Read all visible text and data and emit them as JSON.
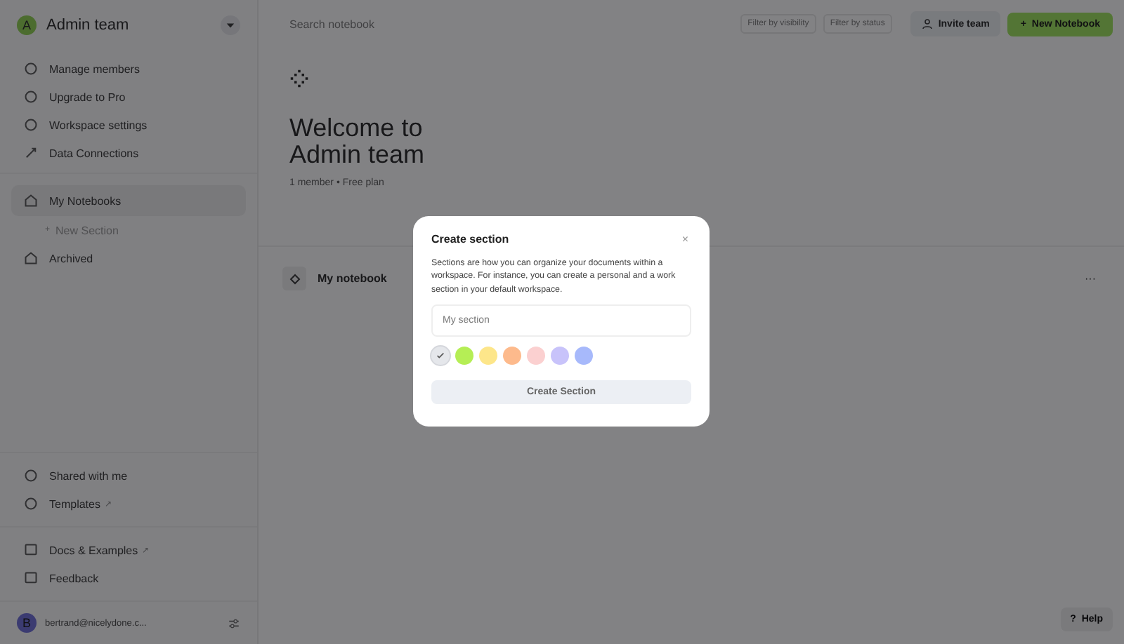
{
  "workspace": {
    "avatar": "A",
    "name": "Admin team"
  },
  "sidebar": {
    "top_items": [
      {
        "label": "Manage members"
      },
      {
        "label": "Upgrade to Pro"
      },
      {
        "label": "Workspace settings"
      },
      {
        "label": "Data Connections"
      }
    ],
    "nav_items": [
      {
        "kind": "item",
        "label": "My Notebooks",
        "selected": true
      },
      {
        "kind": "add",
        "label": "New Section",
        "prefix": "+",
        "selected": false
      },
      {
        "kind": "item",
        "label": "Archived",
        "selected": false
      }
    ],
    "bottom_items": [
      {
        "label": "Shared with me"
      },
      {
        "label": "Templates",
        "external": "↗"
      }
    ],
    "footer_items": [
      {
        "label": "Docs & Examples",
        "external": "↗"
      },
      {
        "label": "Feedback"
      }
    ],
    "user": {
      "avatar": "B",
      "email": "bertrand@nicelydone.c..."
    }
  },
  "topbar": {
    "search": {
      "placeholder": "Search notebook"
    },
    "filters": [
      "Filter by visibility",
      "Filter by status"
    ],
    "invite_button": "Invite team",
    "new_button": "New Notebook",
    "new_prefix": "+"
  },
  "welcome": {
    "title_line1": "Welcome to",
    "title_line2": "Admin team",
    "subtitle": "1 member • Free plan"
  },
  "notebook": {
    "name": "My notebook",
    "more": "···"
  },
  "dialog": {
    "title": "Create section",
    "close": "×",
    "text": "Sections are how you can organize your documents within a workspace. For instance, you can create a personal and a work section in your default workspace.",
    "input": {
      "placeholder": "My section"
    },
    "colors": [
      {
        "color": "#e5e7eb",
        "selected": true
      },
      {
        "color": "#b5ee55",
        "selected": false
      },
      {
        "color": "#fde68a",
        "selected": false
      },
      {
        "color": "#fdba8c",
        "selected": false
      },
      {
        "color": "#fbd0d0",
        "selected": false
      },
      {
        "color": "#c8c3fa",
        "selected": false
      },
      {
        "color": "#a7b9fb",
        "selected": false
      }
    ],
    "button": {
      "label": "Create Section",
      "disabled": true
    }
  },
  "help": {
    "prefix": "?",
    "label": "Help"
  }
}
